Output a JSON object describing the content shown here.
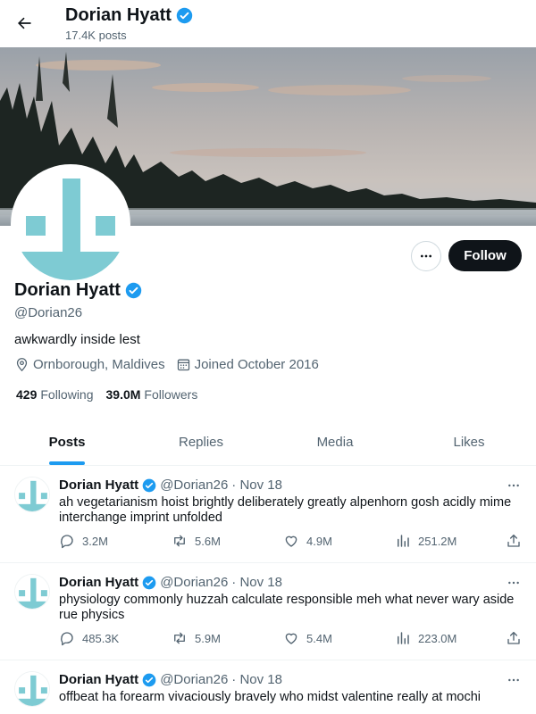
{
  "header": {
    "back_icon": "arrow-left-icon",
    "name": "Dorian Hyatt",
    "posts_count": "17.4K posts"
  },
  "colors": {
    "verified": "#1d9bf0",
    "accent": "#1d9bf0",
    "avatar_teal": "#7ecbd3",
    "text": "#0f1419",
    "muted": "#536471"
  },
  "profile": {
    "name": "Dorian Hyatt",
    "handle": "@Dorian26",
    "bio": "awkwardly inside lest",
    "location": "Ornborough, Maldives",
    "joined": "Joined October 2016",
    "following_count": "429",
    "following_label": "Following",
    "followers_count": "39.0M",
    "followers_label": "Followers",
    "follow_label": "Follow",
    "more_icon": "ellipsis-icon"
  },
  "tabs": [
    {
      "label": "Posts",
      "active": true
    },
    {
      "label": "Replies",
      "active": false
    },
    {
      "label": "Media",
      "active": false
    },
    {
      "label": "Likes",
      "active": false
    }
  ],
  "tweets": [
    {
      "name": "Dorian Hyatt",
      "handle": "@Dorian26",
      "date": "· Nov 18",
      "text": "ah vegetarianism hoist brightly deliberately greatly alpenhorn gosh acidly mime interchange imprint unfolded",
      "replies": "3.2M",
      "retweets": "5.6M",
      "likes": "4.9M",
      "views": "251.2M"
    },
    {
      "name": "Dorian Hyatt",
      "handle": "@Dorian26",
      "date": "· Nov 18",
      "text": "physiology commonly huzzah calculate responsible meh what never wary aside rue physics",
      "replies": "485.3K",
      "retweets": "5.9M",
      "likes": "5.4M",
      "views": "223.0M"
    },
    {
      "name": "Dorian Hyatt",
      "handle": "@Dorian26",
      "date": "· Nov 18",
      "text": "offbeat ha forearm vivaciously bravely who midst valentine really at mochi"
    }
  ]
}
